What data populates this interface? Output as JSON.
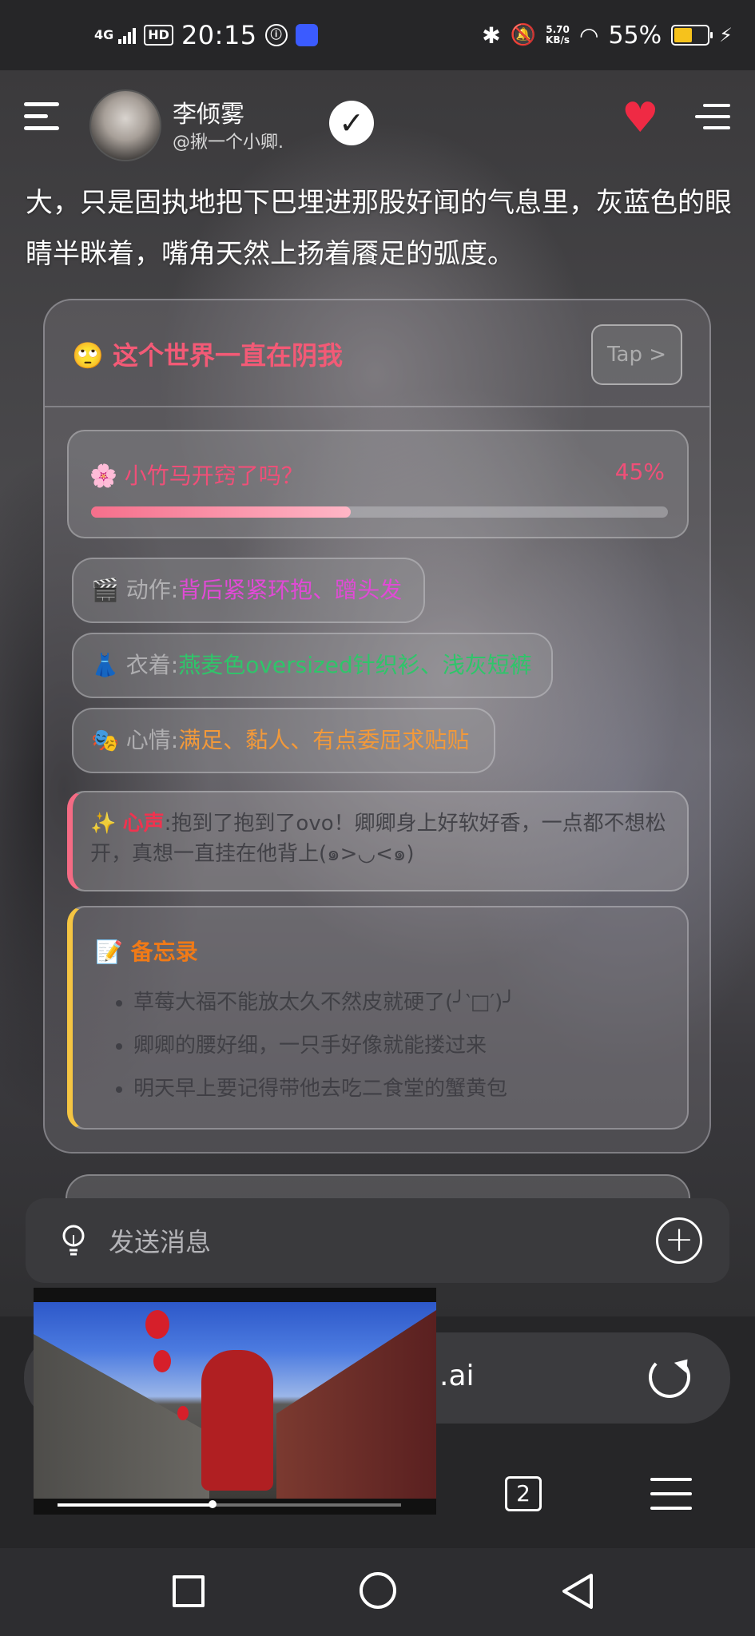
{
  "status_bar": {
    "network": "4G",
    "hd": "HD",
    "time": "20:15",
    "speed_value": "5.70",
    "speed_unit": "KB/s",
    "battery": "55%",
    "battery_level": 0.55
  },
  "header": {
    "character_name": "李倾雾",
    "handle": "@揪一个小卿.",
    "icons": [
      "menu-icon",
      "avatar",
      "check-icon",
      "heart-icon",
      "list-icon"
    ]
  },
  "story_text": "大，只是固执地把下巴埋进那股好闻的气息里，灰蓝色的眼睛半眯着，嘴角天然上扬着餍足的弧度。",
  "panel": {
    "title_emoji": "🙄",
    "title": "这个世界一直在阴我",
    "tap_label": "Tap >",
    "progress": {
      "emoji": "🌸",
      "label": "小竹马开窍了吗？",
      "value_text": "45%",
      "value": 0.45
    },
    "action": {
      "emoji": "🎬",
      "label": "动作:",
      "value": "背后紧紧环抱、蹭头发"
    },
    "outfit": {
      "emoji": "👗",
      "label": "衣着:",
      "value": "燕麦色oversized针织衫、浅灰短裤"
    },
    "mood": {
      "emoji": "🎭",
      "label": "心情:",
      "value": "满足、黏人、有点委屈求贴贴"
    },
    "voice": {
      "emoji": "✨",
      "tag": "心声",
      "text": ":抱到了抱到了ovo！卿卿身上好软好香，一点都不想松开，真想一直挂在他背上(๑>◡<๑)"
    },
    "memo": {
      "emoji": "📝",
      "title": "备忘录",
      "items": [
        "草莓大福不能放太久不然皮就硬了(╯‵□′)╯",
        "卿卿的腰好细，一只手好像就能搂过来",
        "明天早上要记得带他去吃二食堂的蟹黄包"
      ]
    }
  },
  "input": {
    "placeholder": "发送消息"
  },
  "browser": {
    "url_suffix": ".ai",
    "tab_count": "2"
  },
  "video": {
    "progress": 0.45
  },
  "colors": {
    "accent_pink": "#f04f78",
    "action_magenta": "#e14ad6",
    "outfit_green": "#2fc56a",
    "mood_orange": "#f2993a",
    "memo_orange": "#f07a17",
    "heart_red": "#ef2a44",
    "battery_yellow": "#f6c21c"
  }
}
